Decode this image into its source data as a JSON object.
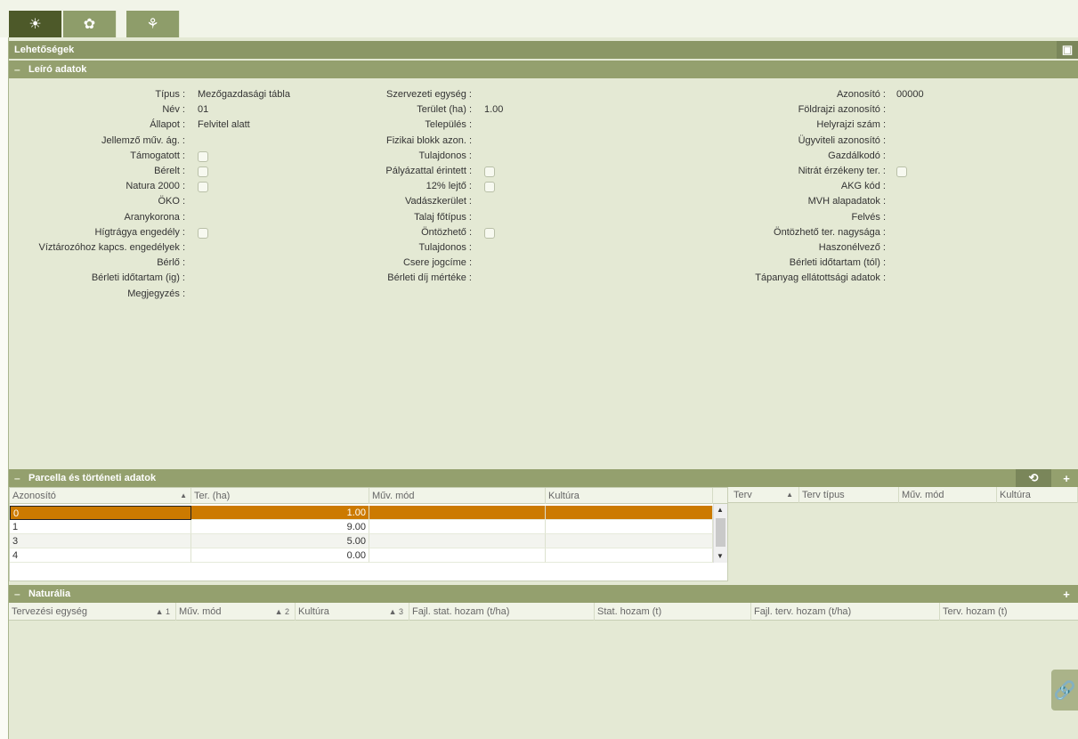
{
  "tabs": [
    {
      "icon": "lightbulb-icon",
      "glyph": "☀",
      "active": true
    },
    {
      "icon": "gear-icon",
      "glyph": "✿",
      "active": false
    },
    {
      "icon": "plant-icon",
      "glyph": "⚘",
      "active": false
    }
  ],
  "panel_title": "Lehetőségek",
  "save_glyph": "▣",
  "descriptive": {
    "title": "Leíró adatok",
    "col1": [
      {
        "label": "Típus :",
        "value": "Mezőgazdasági tábla"
      },
      {
        "label": "Név :",
        "value": "01"
      },
      {
        "label": "Állapot :",
        "value": "Felvitel alatt"
      },
      {
        "label": "Jellemző műv. ág. :",
        "value": ""
      },
      {
        "label": "Támogatott :",
        "checkbox": true
      },
      {
        "label": "Bérelt :",
        "checkbox": true
      },
      {
        "label": "Natura 2000 :",
        "checkbox": true
      },
      {
        "label": "ÖKO :",
        "value": ""
      },
      {
        "label": "Aranykorona :",
        "value": ""
      },
      {
        "label": "Hígtrágya engedély :",
        "checkbox": true
      },
      {
        "label": "Víztározóhoz kapcs. engedélyek :",
        "value": ""
      },
      {
        "label": "Bérlő :",
        "value": ""
      },
      {
        "label": "Bérleti időtartam (ig) :",
        "value": ""
      },
      {
        "label": "Megjegyzés :",
        "value": ""
      }
    ],
    "col2": [
      {
        "label": "Szervezeti egység :",
        "value": ""
      },
      {
        "label": "Terület (ha) :",
        "value": "1.00"
      },
      {
        "label": "Település :",
        "value": ""
      },
      {
        "label": "Fizikai blokk azon. :",
        "value": ""
      },
      {
        "label": "Tulajdonos :",
        "value": ""
      },
      {
        "label": "Pályázattal érintett :",
        "checkbox": true
      },
      {
        "label": "12% lejtő :",
        "checkbox": true
      },
      {
        "label": "Vadászkerület :",
        "value": ""
      },
      {
        "label": "Talaj főtípus :",
        "value": ""
      },
      {
        "label": "Öntözhető :",
        "checkbox": true
      },
      {
        "label": "Tulajdonos :",
        "value": ""
      },
      {
        "label": "Csere jogcíme :",
        "value": ""
      },
      {
        "label": "Bérleti díj mértéke :",
        "value": ""
      }
    ],
    "col3": [
      {
        "label": "Azonosító :",
        "value": "00000"
      },
      {
        "label": "Földrajzi azonosító :",
        "value": ""
      },
      {
        "label": "Helyrajzi szám :",
        "value": ""
      },
      {
        "label": "Ügyviteli azonosító :",
        "value": ""
      },
      {
        "label": "Gazdálkodó :",
        "value": ""
      },
      {
        "label": "Nitrát érzékeny ter. :",
        "checkbox": true
      },
      {
        "label": "AKG kód :",
        "value": ""
      },
      {
        "label": "MVH alapadatok :",
        "value": ""
      },
      {
        "label": "Felvés :",
        "value": ""
      },
      {
        "label": "Öntözhető ter. nagysága :",
        "value": ""
      },
      {
        "label": "Haszonélvező :",
        "value": ""
      },
      {
        "label": "Bérleti időtartam (tól) :",
        "value": ""
      },
      {
        "label": "Tápanyag ellátottsági adatok :",
        "value": ""
      }
    ]
  },
  "parcels": {
    "title": "Parcella és történeti adatok",
    "sync_glyph": "⟲",
    "plus_glyph": "+",
    "columns": [
      "Azonosító",
      "Ter. (ha)",
      "Műv. mód",
      "Kultúra"
    ],
    "sort_glyph": "▲",
    "rows": [
      [
        "0",
        "1.00",
        "",
        ""
      ],
      [
        "1",
        "9.00",
        "",
        ""
      ],
      [
        "3",
        "5.00",
        "",
        ""
      ],
      [
        "4",
        "0.00",
        "",
        ""
      ]
    ],
    "plan_columns": [
      "Terv",
      "Terv típus",
      "Műv. mód",
      "Kultúra"
    ]
  },
  "naturalia": {
    "title": "Naturália",
    "plus_glyph": "+",
    "columns": [
      "Tervezési egység",
      "1",
      "Műv. mód",
      "2",
      "Kultúra",
      "3",
      "Fajl. stat. hozam (t/ha)",
      "Stat. hozam (t)",
      "Fajl. terv. hozam (t/ha)",
      "Terv. hozam (t)"
    ]
  },
  "link_glyph": "🔗"
}
